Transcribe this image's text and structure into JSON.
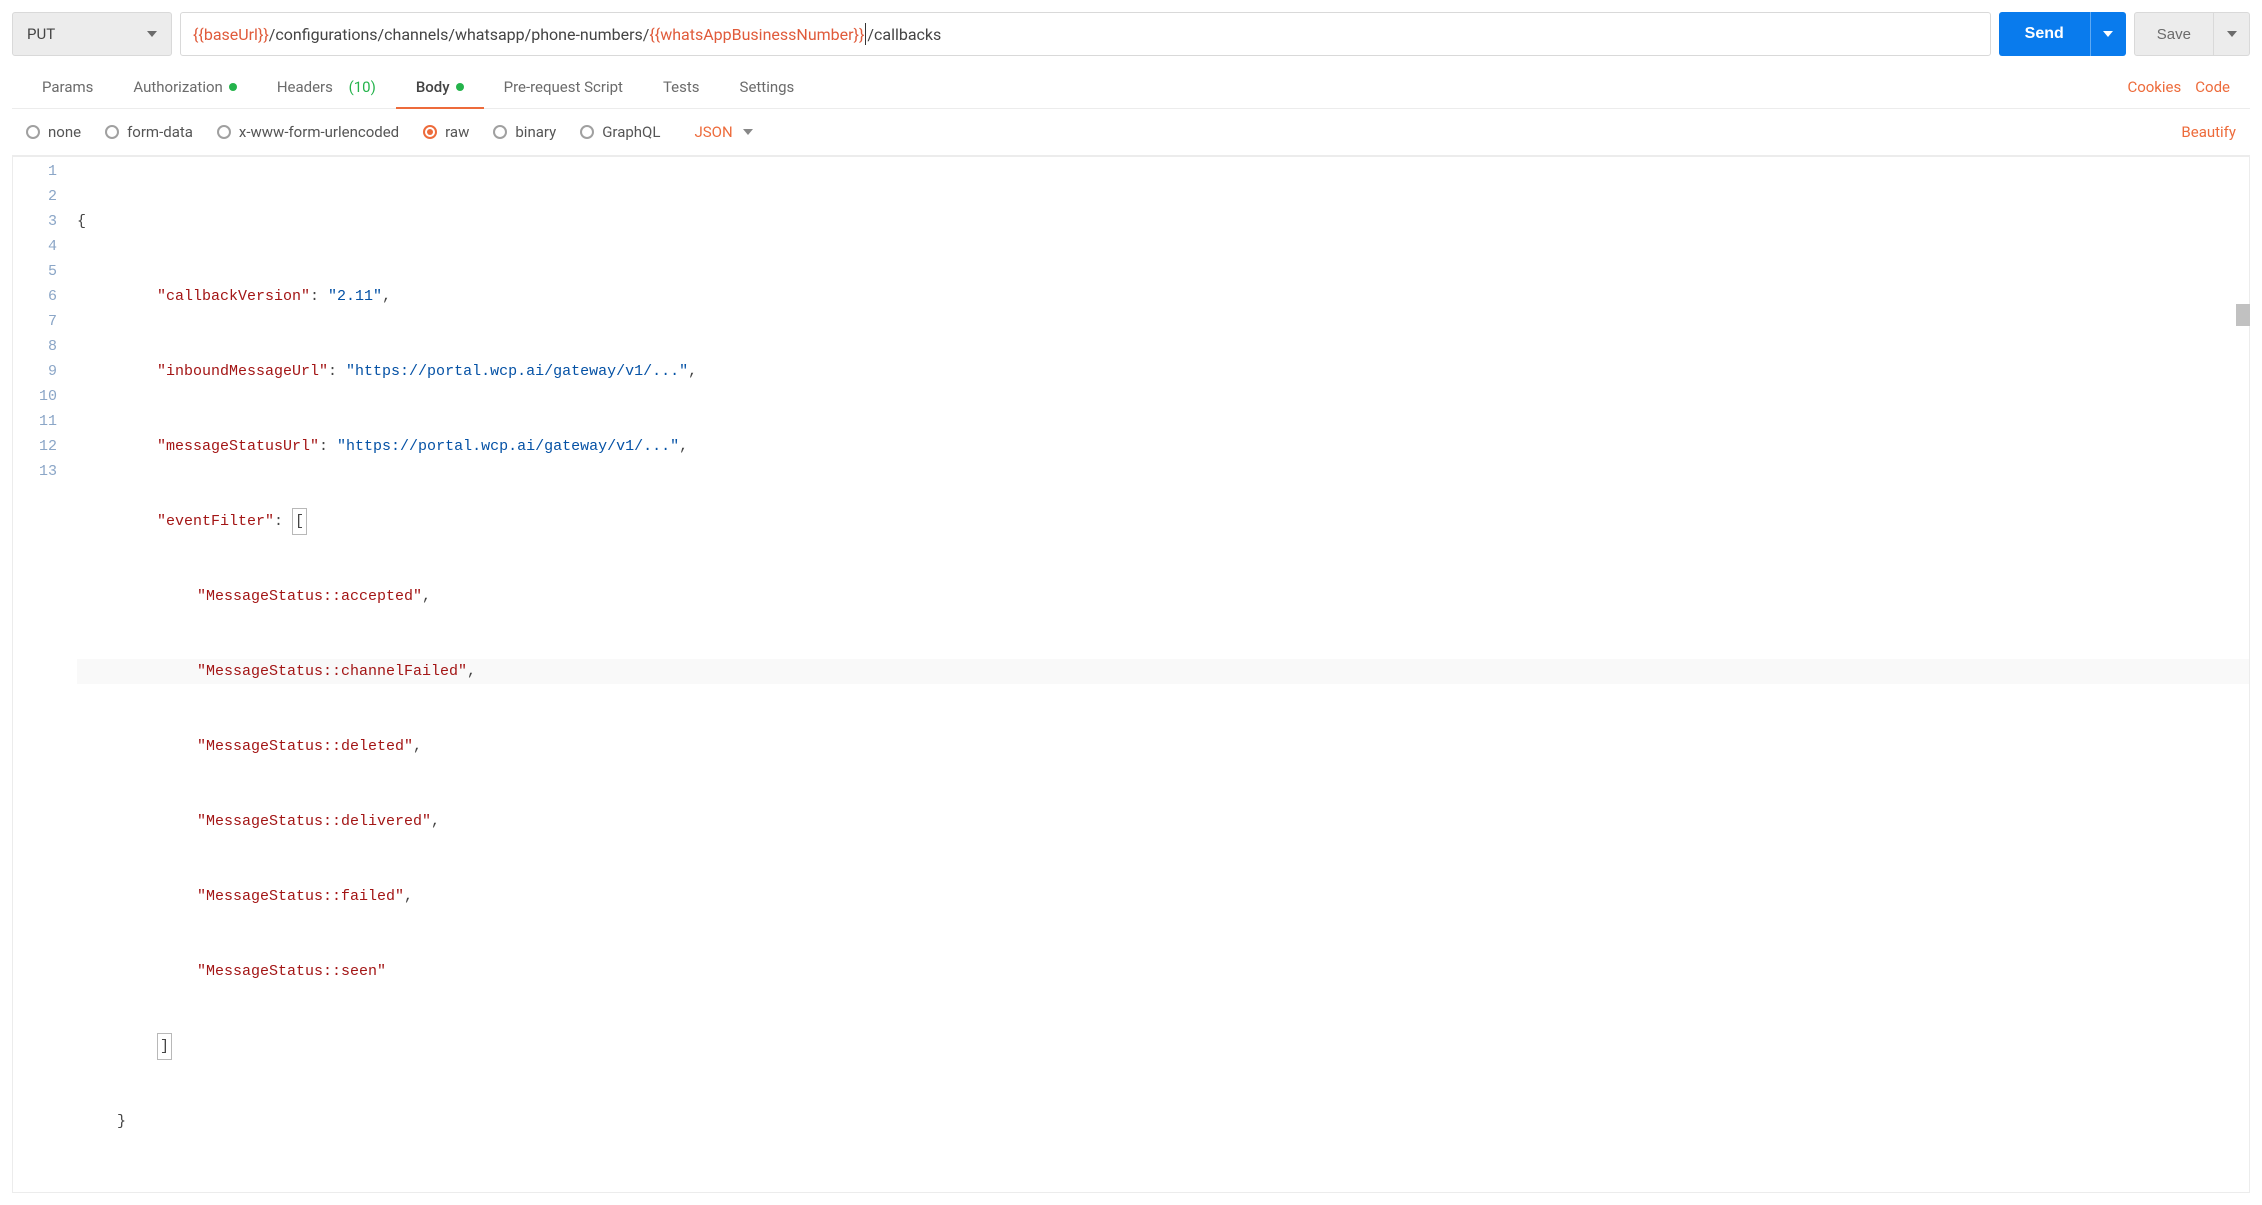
{
  "request": {
    "method": "PUT",
    "url": {
      "var1": "{{baseUrl}}",
      "path1": "/configurations/channels/whatsapp/phone-numbers/",
      "var2": "{{whatsAppBusinessNumber}}",
      "path2": "/callbacks"
    },
    "send_label": "Send",
    "save_label": "Save"
  },
  "tabs": {
    "params": "Params",
    "authorization": "Authorization",
    "headers": "Headers",
    "headers_count": "(10)",
    "body": "Body",
    "prerequest": "Pre-request Script",
    "tests": "Tests",
    "settings": "Settings"
  },
  "right_links": {
    "cookies": "Cookies",
    "code": "Code"
  },
  "body_types": {
    "none": "none",
    "formdata": "form-data",
    "xwww": "x-www-form-urlencoded",
    "raw": "raw",
    "binary": "binary",
    "graphql": "GraphQL",
    "lang": "JSON",
    "beautify": "Beautify"
  },
  "editor": {
    "line_count": 13,
    "tokens": {
      "callbackVersion_key": "\"callbackVersion\"",
      "callbackVersion_val": "\"2.11\"",
      "inboundMessageUrl_key": "\"inboundMessageUrl\"",
      "inboundMessageUrl_val": "\"https://portal.wcp.ai/gateway/v1/...\"",
      "messageStatusUrl_key": "\"messageStatusUrl\"",
      "messageStatusUrl_val": "\"https://portal.wcp.ai/gateway/v1/...\"",
      "eventFilter_key": "\"eventFilter\"",
      "ef0": "\"MessageStatus::accepted\"",
      "ef1": "\"MessageStatus::channelFailed\"",
      "ef2": "\"MessageStatus::deleted\"",
      "ef3": "\"MessageStatus::delivered\"",
      "ef4": "\"MessageStatus::failed\"",
      "ef5": "\"MessageStatus::seen\""
    }
  }
}
